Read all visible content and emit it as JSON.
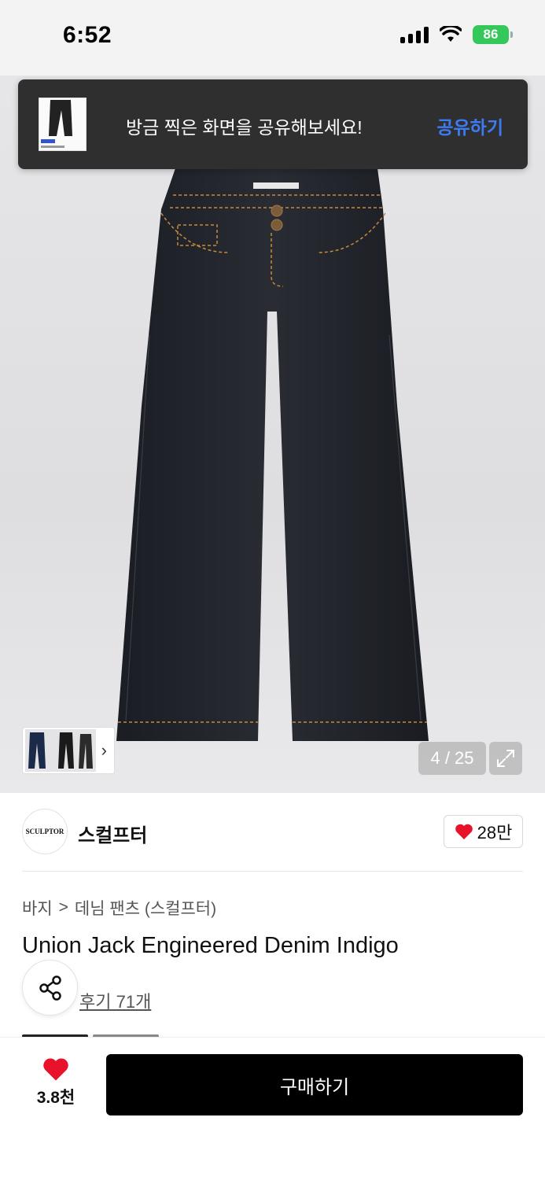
{
  "status_bar": {
    "time": "6:52",
    "battery": "86"
  },
  "toast": {
    "message": "방금 찍은 화면을 공유해보세요!",
    "action": "공유하기"
  },
  "gallery": {
    "counter": "4 / 25",
    "thumb_chevron": "›",
    "expand_icon": "expand-icon"
  },
  "brand": {
    "logo_text": "SCULPTOR",
    "name": "스컬프터",
    "likes": "28만",
    "heart_color": "#e8132b"
  },
  "breadcrumb": {
    "category": "바지",
    "separator": ">",
    "subcategory": "데님 팬츠 (스컬프터)"
  },
  "product": {
    "title": "Union Jack Engineered Denim Indigo",
    "reviews": "후기 71개"
  },
  "bottom": {
    "wish_count": "3.8천",
    "buy_label": "구매하기"
  },
  "colors": {
    "accent_link": "#3d7bf5",
    "battery": "#34c759",
    "button": "#000000"
  }
}
